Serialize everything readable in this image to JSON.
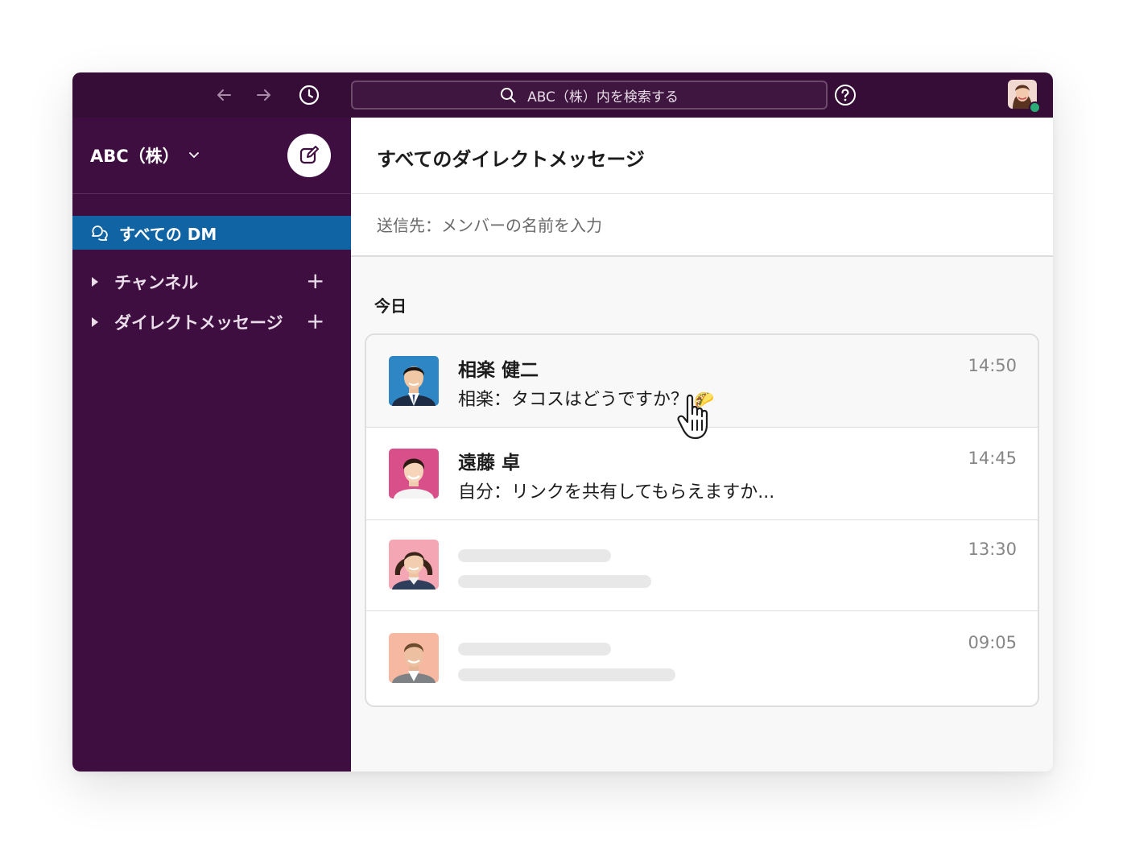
{
  "topbar": {
    "search_placeholder": "ABC（株）内を検索する",
    "icons": {
      "back": "arrow-left-icon",
      "forward": "arrow-right-icon",
      "history": "clock-icon",
      "search": "search-icon",
      "help": "question-circle-icon"
    }
  },
  "sidebar": {
    "workspace_name": "ABC（株）",
    "active_item": "すべての DM",
    "sections": [
      {
        "label": "チャンネル"
      },
      {
        "label": "ダイレクトメッセージ"
      }
    ]
  },
  "main": {
    "title": "すべてのダイレクトメッセージ",
    "to_placeholder": "送信先：メンバーの名前を入力",
    "day_label": "今日",
    "conversations": [
      {
        "name": "相楽 健二",
        "preview": "相楽：タコスはどうですか？",
        "emoji": "🌮",
        "time": "14:50"
      },
      {
        "name": "遠藤 卓",
        "preview": "自分：リンクを共有してもらえますか...",
        "time": "14:45"
      },
      {
        "name": "",
        "preview": "",
        "time": "13:30"
      },
      {
        "name": "",
        "preview": "",
        "time": "09:05"
      }
    ]
  },
  "colors": {
    "topbar": "#350d36",
    "sidebar": "#3f0e40",
    "active": "#1164a3",
    "online": "#2bac76"
  }
}
